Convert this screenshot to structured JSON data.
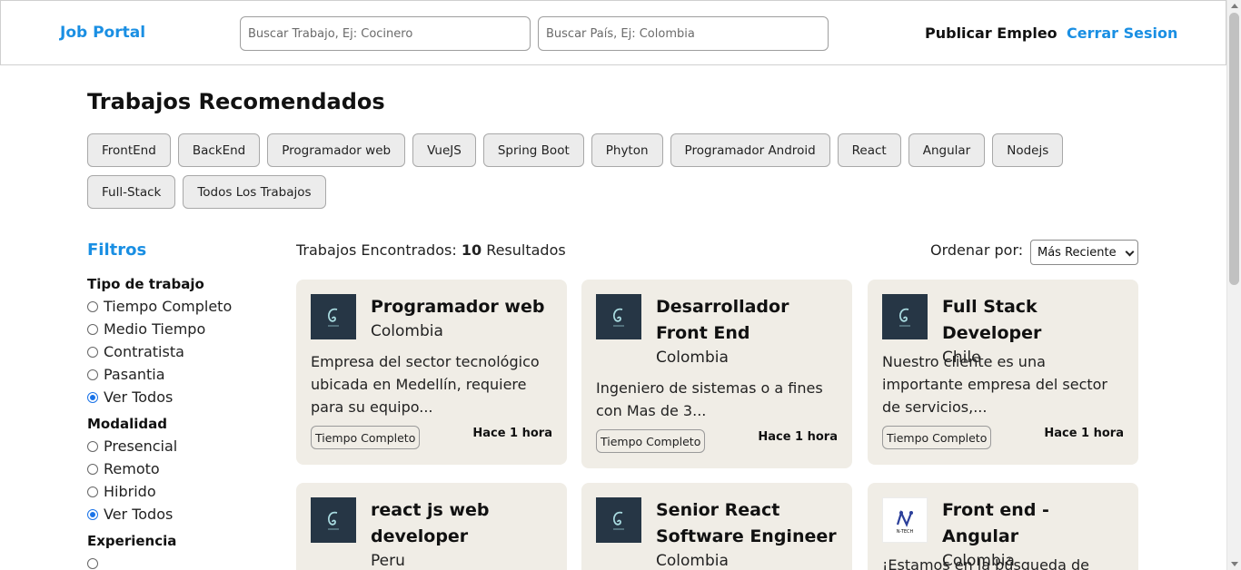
{
  "header": {
    "logo": "Job Portal",
    "search_job_placeholder": "Buscar Trabajo, Ej: Cocinero",
    "search_country_placeholder": "Buscar País, Ej: Colombia",
    "publish_label": "Publicar Empleo",
    "logout_label": "Cerrar Sesion"
  },
  "main": {
    "title": "Trabajos Recomendados",
    "tags": [
      "FrontEnd",
      "BackEnd",
      "Programador web",
      "VueJS",
      "Spring Boot",
      "Phyton",
      "Programador Android",
      "React",
      "Angular",
      "Nodejs",
      "Full-Stack",
      "Todos Los Trabajos"
    ]
  },
  "filters": {
    "title": "Filtros",
    "tipo": {
      "label": "Tipo de trabajo",
      "options": [
        "Tiempo Completo",
        "Medio Tiempo",
        "Contratista",
        "Pasantia",
        "Ver Todos"
      ],
      "selected": "Ver Todos"
    },
    "modalidad": {
      "label": "Modalidad",
      "options": [
        "Presencial",
        "Remoto",
        "Hibrido",
        "Ver Todos"
      ],
      "selected": "Ver Todos"
    },
    "experiencia": {
      "label": "Experiencia"
    }
  },
  "results": {
    "prefix": "Trabajos Encontrados:",
    "count": "10",
    "suffix": "Resultados",
    "sort_label": "Ordenar por:",
    "sort_value": "Más Reciente"
  },
  "cards": [
    {
      "title": "Programador web",
      "country": "Colombia",
      "description": "Empresa del sector tecnológico ubicada en Medellín, requiere para su equipo...",
      "type": "Tiempo Completo",
      "time": "Hace 1 hora",
      "logo": "teal-logo-icon"
    },
    {
      "title": "Desarrollador Front End",
      "country": "Colombia",
      "description": "Ingeniero de sistemas o a fines con Mas de 3...",
      "type": "Tiempo Completo",
      "time": "Hace 1 hora",
      "logo": "teal-logo-icon"
    },
    {
      "title": "Full Stack Developer",
      "country": "Chile",
      "description": "Nuestro cliente es una importante empresa del sector de servicios,...",
      "type": "Tiempo Completo",
      "time": "Hace 1 hora",
      "logo": "teal-logo-icon"
    },
    {
      "title": "react js web developer",
      "country": "Peru",
      "logo": "teal-logo-icon"
    },
    {
      "title": "Senior React Software Engineer",
      "country": "Colombia",
      "logo": "teal-logo-icon"
    },
    {
      "title": "Front end - Angular",
      "country": "Colombia",
      "description": "¡Estamos en la búsqueda de",
      "logo": "n-tech-logo-icon",
      "logo_text": "N-TECH"
    }
  ]
}
